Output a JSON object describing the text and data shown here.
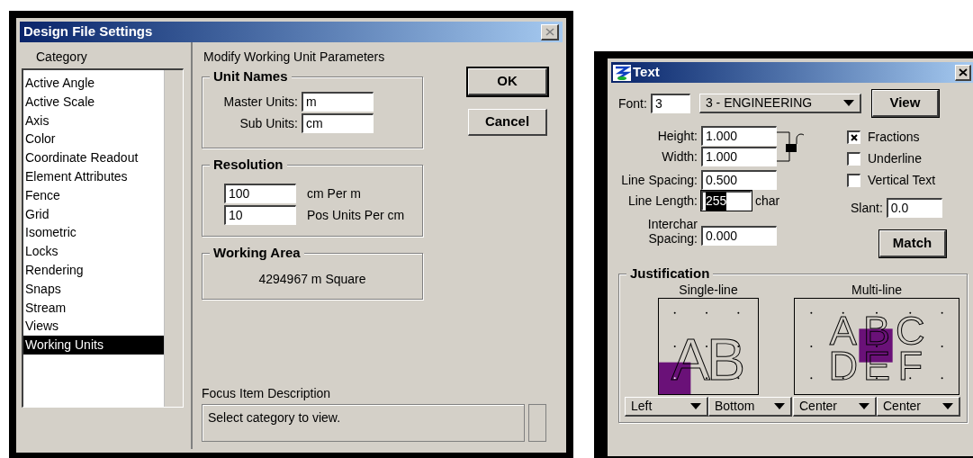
{
  "design_file_settings": {
    "title": "Design File Settings",
    "category_label": "Category",
    "categories": [
      {
        "label": "Active Angle",
        "selected": false
      },
      {
        "label": "Active Scale",
        "selected": false
      },
      {
        "label": "Axis",
        "selected": false
      },
      {
        "label": "Color",
        "selected": false
      },
      {
        "label": "Coordinate Readout",
        "selected": false
      },
      {
        "label": "Element Attributes",
        "selected": false
      },
      {
        "label": "Fence",
        "selected": false
      },
      {
        "label": "Grid",
        "selected": false
      },
      {
        "label": "Isometric",
        "selected": false
      },
      {
        "label": "Locks",
        "selected": false
      },
      {
        "label": "Rendering",
        "selected": false
      },
      {
        "label": "Snaps",
        "selected": false
      },
      {
        "label": "Stream",
        "selected": false
      },
      {
        "label": "Views",
        "selected": false
      },
      {
        "label": "Working Units",
        "selected": true
      }
    ],
    "heading": "Modify Working Unit Parameters",
    "unit_names": {
      "title": "Unit Names",
      "fields": [
        {
          "label": "Master Units:",
          "value": "m"
        },
        {
          "label": "Sub Units:",
          "value": "cm"
        }
      ]
    },
    "resolution": {
      "title": "Resolution",
      "fields": [
        {
          "value": "100",
          "unit": "cm Per m"
        },
        {
          "value": "10",
          "unit": "Pos Units Per cm"
        }
      ]
    },
    "working_area": {
      "title": "Working Area",
      "value": "4294967 m Square"
    },
    "buttons": [
      {
        "label": "OK",
        "default": true
      },
      {
        "label": "Cancel",
        "default": false
      }
    ],
    "focus_description": {
      "label": "Focus Item Description",
      "text": "Select category to view."
    }
  },
  "text_dialog": {
    "title": "Text",
    "font": {
      "label": "Font:",
      "value": "3",
      "selection": "3 - ENGINEERING"
    },
    "view_button": "View",
    "size_fields": [
      {
        "label": "Height:",
        "value": "1.000"
      },
      {
        "label": "Width:",
        "value": "1.000"
      }
    ],
    "size_locked": false,
    "line_spacing": {
      "label": "Line Spacing:",
      "value": "0.500"
    },
    "line_length": {
      "label": "Line Length:",
      "value": "255",
      "unit": "char",
      "selected": true
    },
    "interchar": {
      "label": "Interchar Spacing:",
      "value": "0.000"
    },
    "options": [
      {
        "label": "Fractions",
        "checked": true
      },
      {
        "label": "Underline",
        "checked": false
      },
      {
        "label": "Vertical Text",
        "checked": false
      }
    ],
    "slant": {
      "label": "Slant:",
      "value": "0.0"
    },
    "match_button": "Match",
    "justification": {
      "title": "Justification",
      "single_line": {
        "label": "Single-line",
        "glyphs": [
          "A",
          "B"
        ],
        "dropdowns": [
          "Left",
          "Bottom"
        ]
      },
      "multi_line": {
        "label": "Multi-line",
        "glyphs": [
          "A",
          "B",
          "C",
          "D",
          "E",
          "F"
        ],
        "dropdowns": [
          "Center",
          "Center"
        ]
      }
    }
  }
}
